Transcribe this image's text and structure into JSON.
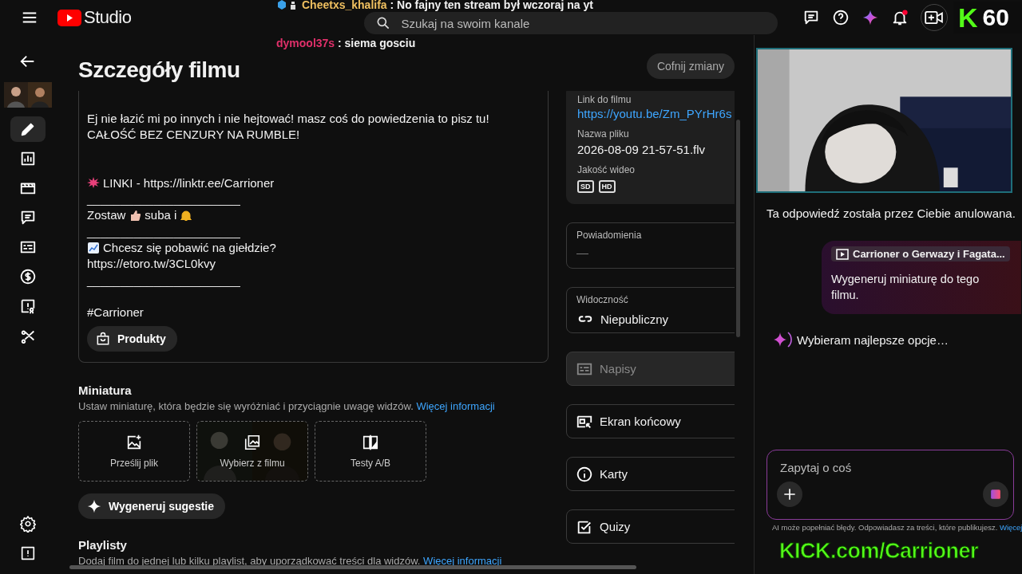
{
  "topbar": {
    "logo_text": "Studio",
    "search": {
      "placeholder": "Szukaj na swoim kanale"
    },
    "icons": [
      {
        "kind": "feedback"
      },
      {
        "kind": "help"
      },
      {
        "kind": "sparkle"
      },
      {
        "kind": "bell",
        "dot": true
      }
    ]
  },
  "stream_chat": [
    {
      "badges": true,
      "user": "Cheetxs_khalifa",
      "color": "#f0c060",
      "text": ": No fajny ten stream był wczoraj na yt"
    },
    {
      "badges": false,
      "user": "dymool37s",
      "color": "#e0306a",
      "text": ": siema gosciu"
    }
  ],
  "stream_badge": {
    "logo": "K",
    "viewers": "60"
  },
  "nav": [
    {
      "kind": "edit",
      "selected": true
    },
    {
      "kind": "analytics",
      "selected": false
    },
    {
      "kind": "editor",
      "selected": false
    },
    {
      "kind": "comments",
      "selected": false
    },
    {
      "kind": "subtitles",
      "selected": false
    },
    {
      "kind": "earn",
      "selected": false
    },
    {
      "kind": "copyright",
      "selected": false
    },
    {
      "kind": "clips",
      "selected": false
    }
  ],
  "nav_bottom": [
    {
      "kind": "settings"
    },
    {
      "kind": "feedback"
    }
  ],
  "page": {
    "title": "Szczegóły filmu",
    "undo_button": "Cofnij zmiany"
  },
  "description": [
    {
      "parts": [
        {
          "kind": "text",
          "text": "Ej nie łazić mi po innych i nie hejtować! masz coś do powiedzenia to pisz tu!"
        }
      ]
    },
    {
      "parts": [
        {
          "kind": "text",
          "text": "CAŁOŚĆ BEZ CENZURY NA RUMBLE!"
        }
      ]
    },
    {
      "kind": "blank"
    },
    {
      "kind": "blank"
    },
    {
      "parts": [
        {
          "kind": "burst"
        },
        {
          "kind": "text",
          "text": "LINKI - https://linktr.ee/Carrioner"
        }
      ]
    },
    {
      "parts": [
        {
          "kind": "text",
          "text": "_______________________"
        }
      ]
    },
    {
      "parts": [
        {
          "kind": "text",
          "text": "Zostaw"
        },
        {
          "kind": "thumb"
        },
        {
          "kind": "text",
          "text": "suba i"
        },
        {
          "kind": "bell"
        }
      ]
    },
    {
      "parts": [
        {
          "kind": "text",
          "text": "_______________________"
        }
      ]
    },
    {
      "parts": [
        {
          "kind": "chart"
        },
        {
          "kind": "text",
          "text": "Chcesz się pobawić na giełdzie?"
        }
      ]
    },
    {
      "parts": [
        {
          "kind": "text",
          "text": "https://etoro.tw/3CL0kvy"
        }
      ]
    },
    {
      "parts": [
        {
          "kind": "text",
          "text": "_______________________"
        }
      ]
    },
    {
      "kind": "blank"
    },
    {
      "parts": [
        {
          "kind": "text",
          "text": "#Carrioner"
        }
      ]
    }
  ],
  "products_button": "Produkty",
  "thumbnail": {
    "title": "Miniatura",
    "text": "Ustaw miniaturę, która będzie się wyróżniać i przyciągnie uwagę widzów.",
    "link": "Więcej informacji",
    "options": [
      {
        "kind": "upload",
        "label": "Prześlij plik"
      },
      {
        "kind": "from_video",
        "label": "Wybierz z filmu"
      },
      {
        "kind": "ab_test",
        "label": "Testy A/B"
      }
    ],
    "generate_button": "Wygeneruj sugestie"
  },
  "playlists": {
    "title": "Playlisty",
    "text": "Dodaj film do jednej lub kilku playlist, aby uporządkować treści dla widzów.",
    "link": "Więcej informacji"
  },
  "info_card": {
    "link_label": "Link do filmu",
    "link": "https://youtu.be/Zm_PYrHr6s",
    "file_label": "Nazwa pliku",
    "file": "2026-08-09 21-57-51.flv",
    "quality_label": "Jakość wideo",
    "qualities": [
      "SD",
      "HD"
    ]
  },
  "side_items": [
    {
      "kind": "notifications",
      "label": "Powiadomienia",
      "value": "—"
    },
    {
      "kind": "visibility",
      "label": "Widoczność",
      "value": "Niepubliczny"
    },
    {
      "kind": "subtitles",
      "label": "Napisy",
      "disabled": true
    },
    {
      "kind": "end_screen",
      "label": "Ekran końcowy",
      "disabled": false
    },
    {
      "kind": "cards",
      "label": "Karty",
      "disabled": false
    },
    {
      "kind": "quiz",
      "label": "Quizy",
      "disabled": false
    }
  ],
  "assistant": {
    "cancelled": "Ta odpowiedź została przez Ciebie anulowana.",
    "video_chip": "Carrioner o Gerwazy i Fagata...",
    "user_message": "Wygeneruj miniaturę do tego filmu.",
    "status": "Wybieram najlepsze opcje…",
    "input": {
      "placeholder": "Zapytaj o coś"
    },
    "disclaimer": "AI może popełniać błędy. Odpowiadasz za treści, które publikujesz.",
    "disclaimer_link": "Więcej"
  },
  "stream_overlay": "KICK.com/Carrioner"
}
